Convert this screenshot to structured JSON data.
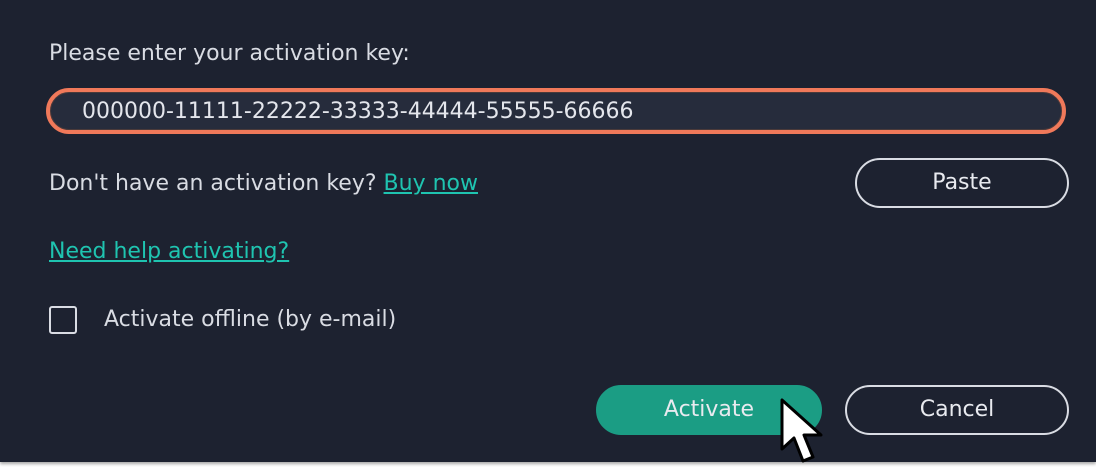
{
  "activation": {
    "prompt": "Please enter your activation key:",
    "key_value": "000000-11111-22222-33333-44444-55555-66666",
    "no_key_text": "Don't have an activation key?",
    "buy_now_link": "Buy now",
    "paste_label": "Paste",
    "help_link": "Need help activating?",
    "offline_label": "Activate offline (by e-mail)",
    "offline_checked": false,
    "activate_label": "Activate",
    "cancel_label": "Cancel"
  },
  "colors": {
    "dialog_bg": "#1d2230",
    "field_border_focus": "#f0795a",
    "link": "#1fc4b0",
    "primary_button": "#1b9d84",
    "text": "#d9dce3"
  },
  "icons": {
    "cursor": "mouse-pointer-icon"
  }
}
